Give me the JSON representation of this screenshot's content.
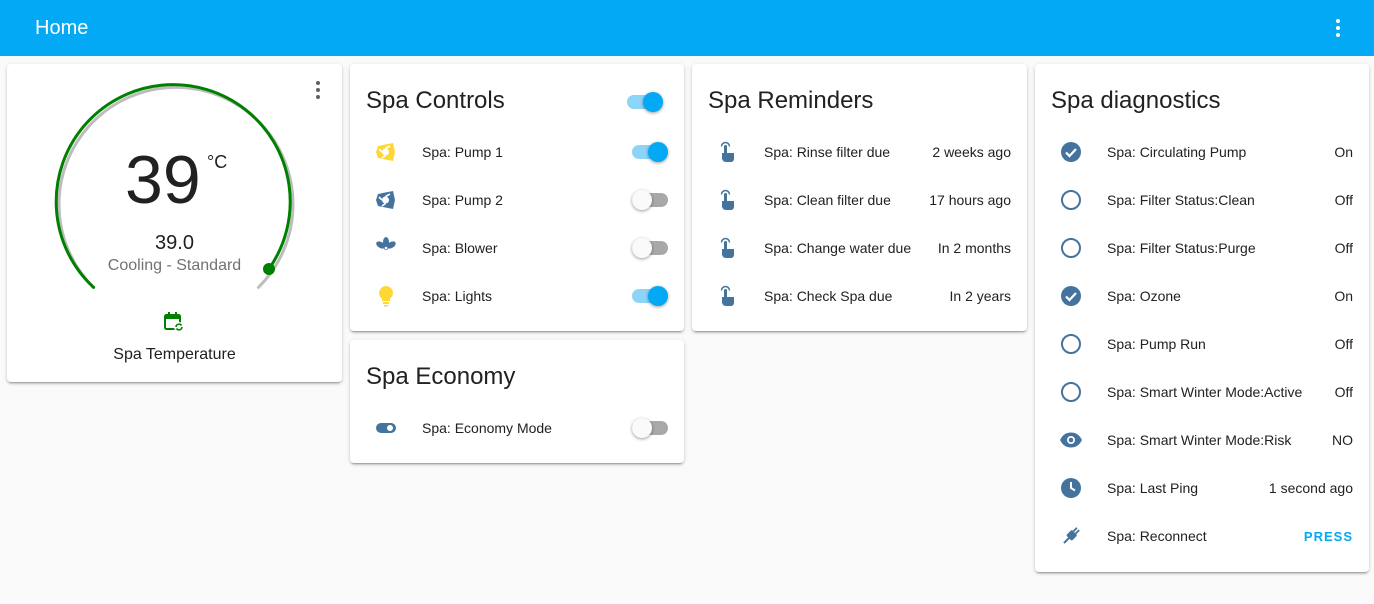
{
  "header": {
    "title": "Home",
    "menu_icon": "dots-vertical-icon"
  },
  "thermostat": {
    "current": "39",
    "unit": "°C",
    "target": "39.0",
    "mode": "Cooling - Standard",
    "name": "Spa Temperature",
    "accent": "#008000",
    "schedule_icon": "calendar-sync-icon"
  },
  "spa_controls": {
    "title": "Spa Controls",
    "header_toggle": true,
    "items": [
      {
        "label": "Spa: Pump 1",
        "icon": "pump-icon",
        "icon_color": "#fdd835",
        "on": true
      },
      {
        "label": "Spa: Pump 2",
        "icon": "pump-icon",
        "icon_color": "#44739e",
        "on": false
      },
      {
        "label": "Spa: Blower",
        "icon": "fan-icon",
        "icon_color": "#44739e",
        "on": false
      },
      {
        "label": "Spa: Lights",
        "icon": "lightbulb-icon",
        "icon_color": "#fdd835",
        "on": true
      }
    ]
  },
  "spa_economy": {
    "title": "Spa Economy",
    "items": [
      {
        "label": "Spa: Economy Mode",
        "icon": "toggle-switch-icon",
        "on": false
      }
    ]
  },
  "spa_reminders": {
    "title": "Spa Reminders",
    "items": [
      {
        "label": "Spa: Rinse filter due",
        "value": "2 weeks ago",
        "icon": "gesture-tap-icon"
      },
      {
        "label": "Spa: Clean filter due",
        "value": "17 hours ago",
        "icon": "gesture-tap-icon"
      },
      {
        "label": "Spa: Change water due",
        "value": "In 2 months",
        "icon": "gesture-tap-icon"
      },
      {
        "label": "Spa: Check Spa due",
        "value": "In 2 years",
        "icon": "gesture-tap-icon"
      }
    ]
  },
  "spa_diagnostics": {
    "title": "Spa diagnostics",
    "items": [
      {
        "label": "Spa: Circulating Pump",
        "value": "On",
        "icon": "check-circle-icon"
      },
      {
        "label": "Spa: Filter Status:Clean",
        "value": "Off",
        "icon": "circle-outline-icon"
      },
      {
        "label": "Spa: Filter Status:Purge",
        "value": "Off",
        "icon": "circle-outline-icon"
      },
      {
        "label": "Spa: Ozone",
        "value": "On",
        "icon": "check-circle-icon"
      },
      {
        "label": "Spa: Pump Run",
        "value": "Off",
        "icon": "circle-outline-icon"
      },
      {
        "label": "Spa: Smart Winter Mode:Active",
        "value": "Off",
        "icon": "circle-outline-icon"
      },
      {
        "label": "Spa: Smart Winter Mode:Risk",
        "value": "NO",
        "icon": "eye-icon"
      },
      {
        "label": "Spa: Last Ping",
        "value": "1 second ago",
        "icon": "clock-icon"
      },
      {
        "label": "Spa: Reconnect",
        "value": "PRESS",
        "icon": "power-plug-icon"
      }
    ]
  },
  "colors": {
    "header": "#03a9f4",
    "icon": "#44739e",
    "active": "#fdd835",
    "toggle_on": "#03a9f4"
  }
}
